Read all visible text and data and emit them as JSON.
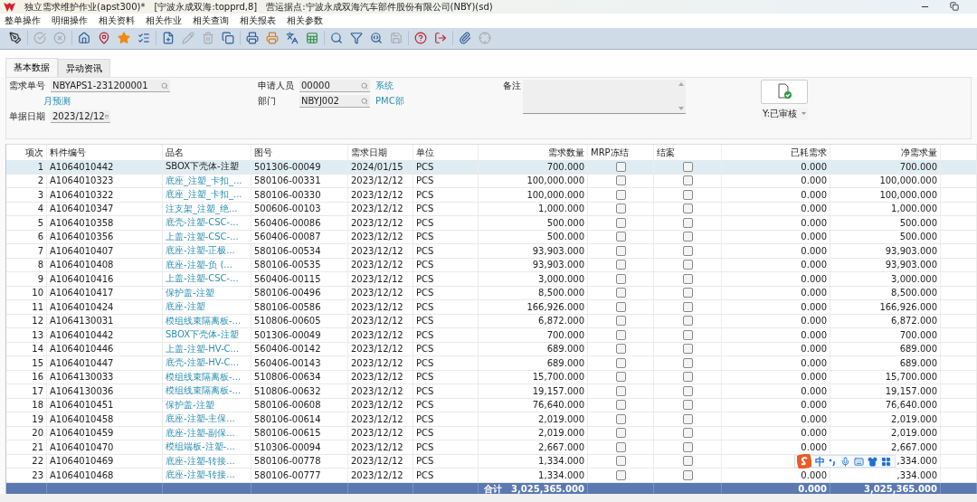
{
  "window": {
    "title": "独立需求维护作业(apst300)*",
    "connection": "[宁波永成双海:topprd,8]",
    "site": "营运据点:宁波永成双海汽车部件股份有限公司(NBY)(sd)"
  },
  "menu": [
    "整单操作",
    "明细操作",
    "相关资料",
    "相关作业",
    "相关查询",
    "相关报表",
    "相关参数"
  ],
  "toolbar": [
    [
      {
        "kind": "sign",
        "disabled": false
      }
    ],
    [
      {
        "kind": "confirm",
        "disabled": true
      },
      {
        "kind": "cancel",
        "disabled": true
      }
    ],
    [
      {
        "kind": "home",
        "disabled": false
      },
      {
        "kind": "pin",
        "disabled": false
      },
      {
        "kind": "star",
        "disabled": false
      },
      {
        "kind": "list",
        "disabled": false
      }
    ],
    [
      {
        "kind": "add",
        "disabled": false
      },
      {
        "kind": "edit",
        "disabled": true
      },
      {
        "kind": "delete",
        "disabled": true
      },
      {
        "kind": "copy",
        "disabled": false
      }
    ],
    [
      {
        "kind": "print",
        "disabled": false
      },
      {
        "kind": "print2",
        "disabled": false
      },
      {
        "kind": "translate",
        "disabled": false
      },
      {
        "kind": "excel",
        "disabled": false
      }
    ],
    [
      {
        "kind": "search",
        "disabled": false
      },
      {
        "kind": "filter",
        "disabled": false
      },
      {
        "kind": "query",
        "disabled": false
      },
      {
        "kind": "save",
        "disabled": true
      }
    ],
    [
      {
        "kind": "help",
        "disabled": false
      },
      {
        "kind": "exit",
        "disabled": false
      }
    ],
    [
      {
        "kind": "attach",
        "disabled": false
      },
      {
        "kind": "target",
        "disabled": true
      }
    ]
  ],
  "tabs": [
    {
      "label": "基本数据",
      "selected": true
    },
    {
      "label": "异动资讯",
      "selected": false
    }
  ],
  "form": {
    "doc_no": {
      "label": "需求单号",
      "value": "NBYAPS1-231200001",
      "note": "月预测"
    },
    "doc_date": {
      "label": "单据日期",
      "value": "2023/12/12"
    },
    "applicant": {
      "label": "申请人员",
      "value": "00000",
      "note": "系统"
    },
    "department": {
      "label": "部门",
      "value": "NBYJ002",
      "note": "PMC部"
    },
    "remark": {
      "label": "备注"
    },
    "status": {
      "value": "Y:已审核"
    }
  },
  "table": {
    "columns": [
      "项次",
      "料件编号",
      "品名",
      "图号",
      "需求日期",
      "单位",
      "需求数量",
      "MRP冻结",
      "结案",
      "已耗需求",
      "净需求量"
    ],
    "rows": [
      {
        "no": "1",
        "part": "A1064010442",
        "name": "SBOX下壳体-注塑",
        "drawing": "501306-00049",
        "date": "2024/01/15",
        "unit": "PCS",
        "qty": "700.000",
        "mrp_frozen": false,
        "closed": false,
        "consumed": "0.000",
        "net": "700.000",
        "selected": true
      },
      {
        "no": "2",
        "part": "A1064010323",
        "name": "底座_注塑_卡扣_...",
        "drawing": "580106-00331",
        "date": "2023/12/12",
        "unit": "PCS",
        "qty": "100,000.000",
        "mrp_frozen": false,
        "closed": false,
        "consumed": "0.000",
        "net": "100,000.000",
        "selected": false
      },
      {
        "no": "3",
        "part": "A1064010322",
        "name": "底座_注塑_卡扣_...",
        "drawing": "580106-00330",
        "date": "2023/12/12",
        "unit": "PCS",
        "qty": "100,000.000",
        "mrp_frozen": false,
        "closed": false,
        "consumed": "0.000",
        "net": "100,000.000",
        "selected": false
      },
      {
        "no": "4",
        "part": "A1064010347",
        "name": "注支架_注塑_绝...",
        "drawing": "500606-00103",
        "date": "2023/12/12",
        "unit": "PCS",
        "qty": "1,000.000",
        "mrp_frozen": false,
        "closed": false,
        "consumed": "0.000",
        "net": "1,000.000",
        "selected": false
      },
      {
        "no": "5",
        "part": "A1064010358",
        "name": "底壳-注塑-CSC-...",
        "drawing": "560406-00086",
        "date": "2023/12/12",
        "unit": "PCS",
        "qty": "500.000",
        "mrp_frozen": false,
        "closed": false,
        "consumed": "0.000",
        "net": "500.000",
        "selected": false
      },
      {
        "no": "6",
        "part": "A1064010356",
        "name": "上盖-注塑-CSC-...",
        "drawing": "560406-00087",
        "date": "2023/12/12",
        "unit": "PCS",
        "qty": "500.000",
        "mrp_frozen": false,
        "closed": false,
        "consumed": "0.000",
        "net": "500.000",
        "selected": false
      },
      {
        "no": "7",
        "part": "A1064010407",
        "name": "底座-注塑-正极...",
        "drawing": "580106-00534",
        "date": "2023/12/12",
        "unit": "PCS",
        "qty": "93,903.000",
        "mrp_frozen": false,
        "closed": false,
        "consumed": "0.000",
        "net": "93,903.000",
        "selected": false
      },
      {
        "no": "8",
        "part": "A1064010408",
        "name": "底座-注塑-负 (...",
        "drawing": "580106-00535",
        "date": "2023/12/12",
        "unit": "PCS",
        "qty": "93,903.000",
        "mrp_frozen": false,
        "closed": false,
        "consumed": "0.000",
        "net": "93,903.000",
        "selected": false
      },
      {
        "no": "9",
        "part": "A1064010416",
        "name": "上盖-注塑-CSC-...",
        "drawing": "560406-00115",
        "date": "2023/12/12",
        "unit": "PCS",
        "qty": "3,000.000",
        "mrp_frozen": false,
        "closed": false,
        "consumed": "0.000",
        "net": "3,000.000",
        "selected": false
      },
      {
        "no": "10",
        "part": "A1064010417",
        "name": "保护盖-注塑",
        "drawing": "580106-00496",
        "date": "2023/12/12",
        "unit": "PCS",
        "qty": "8,500.000",
        "mrp_frozen": false,
        "closed": false,
        "consumed": "0.000",
        "net": "8,500.000",
        "selected": false
      },
      {
        "no": "11",
        "part": "A1064010424",
        "name": "底座-注塑",
        "drawing": "580106-00586",
        "date": "2023/12/12",
        "unit": "PCS",
        "qty": "166,926.000",
        "mrp_frozen": false,
        "closed": false,
        "consumed": "0.000",
        "net": "166,926.000",
        "selected": false
      },
      {
        "no": "12",
        "part": "A1064130031",
        "name": "模组线束隔离板-...",
        "drawing": "510806-00605",
        "date": "2023/12/12",
        "unit": "PCS",
        "qty": "6,872.000",
        "mrp_frozen": false,
        "closed": false,
        "consumed": "0.000",
        "net": "6,872.000",
        "selected": false
      },
      {
        "no": "13",
        "part": "A1064010442",
        "name": "SBOX下壳体-注塑",
        "drawing": "501306-00049",
        "date": "2023/12/12",
        "unit": "PCS",
        "qty": "700.000",
        "mrp_frozen": false,
        "closed": false,
        "consumed": "0.000",
        "net": "700.000",
        "selected": false
      },
      {
        "no": "14",
        "part": "A1064010446",
        "name": "上盖-注塑-HV-C...",
        "drawing": "560406-00142",
        "date": "2023/12/12",
        "unit": "PCS",
        "qty": "689.000",
        "mrp_frozen": false,
        "closed": false,
        "consumed": "0.000",
        "net": "689.000",
        "selected": false
      },
      {
        "no": "15",
        "part": "A1064010447",
        "name": "底壳-注塑-HV-C...",
        "drawing": "560406-00143",
        "date": "2023/12/12",
        "unit": "PCS",
        "qty": "689.000",
        "mrp_frozen": false,
        "closed": false,
        "consumed": "0.000",
        "net": "689.000",
        "selected": false
      },
      {
        "no": "16",
        "part": "A1064130033",
        "name": "模组线束隔离板-...",
        "drawing": "510806-00634",
        "date": "2023/12/12",
        "unit": "PCS",
        "qty": "15,700.000",
        "mrp_frozen": false,
        "closed": false,
        "consumed": "0.000",
        "net": "15,700.000",
        "selected": false
      },
      {
        "no": "17",
        "part": "A1064130036",
        "name": "模组线束隔离板-...",
        "drawing": "510806-00632",
        "date": "2023/12/12",
        "unit": "PCS",
        "qty": "19,157.000",
        "mrp_frozen": false,
        "closed": false,
        "consumed": "0.000",
        "net": "19,157.000",
        "selected": false
      },
      {
        "no": "18",
        "part": "A1064010451",
        "name": "保护盖-注塑",
        "drawing": "580106-00608",
        "date": "2023/12/12",
        "unit": "PCS",
        "qty": "76,640.000",
        "mrp_frozen": false,
        "closed": false,
        "consumed": "0.000",
        "net": "76,640.000",
        "selected": false
      },
      {
        "no": "19",
        "part": "A1064010458",
        "name": "底座-注塑-主保...",
        "drawing": "580106-00614",
        "date": "2023/12/12",
        "unit": "PCS",
        "qty": "2,019.000",
        "mrp_frozen": false,
        "closed": false,
        "consumed": "0.000",
        "net": "2,019.000",
        "selected": false
      },
      {
        "no": "20",
        "part": "A1064010459",
        "name": "底座-注塑-副保...",
        "drawing": "580106-00615",
        "date": "2023/12/12",
        "unit": "PCS",
        "qty": "2,019.000",
        "mrp_frozen": false,
        "closed": false,
        "consumed": "0.000",
        "net": "2,019.000",
        "selected": false
      },
      {
        "no": "21",
        "part": "A1064010470",
        "name": "模组端板-注塑-...",
        "drawing": "510306-00094",
        "date": "2023/12/12",
        "unit": "PCS",
        "qty": "2,667.000",
        "mrp_frozen": false,
        "closed": false,
        "consumed": "0.000",
        "net": "2,667.000",
        "selected": false
      },
      {
        "no": "22",
        "part": "A1064010469",
        "name": "底座-注塑-转接...",
        "drawing": "580106-00778",
        "date": "2023/12/12",
        "unit": "PCS",
        "qty": "1,334.000",
        "mrp_frozen": false,
        "closed": false,
        "net": ",334.000",
        "selected": false
      },
      {
        "no": "23",
        "part": "A1064010468",
        "name": "底座-注塑-转接...",
        "drawing": "580106-00777",
        "date": "2023/12/12",
        "unit": "PCS",
        "qty": "1,334.000",
        "mrp_frozen": false,
        "closed": false,
        "consumed": "0.000",
        "net": ",334.000",
        "selected": false
      }
    ],
    "totals": {
      "label": "合计",
      "qty": "3,025,365.000",
      "consumed": "0.000",
      "net": "3,025,365.000"
    }
  },
  "ime": {
    "mode": "中"
  }
}
